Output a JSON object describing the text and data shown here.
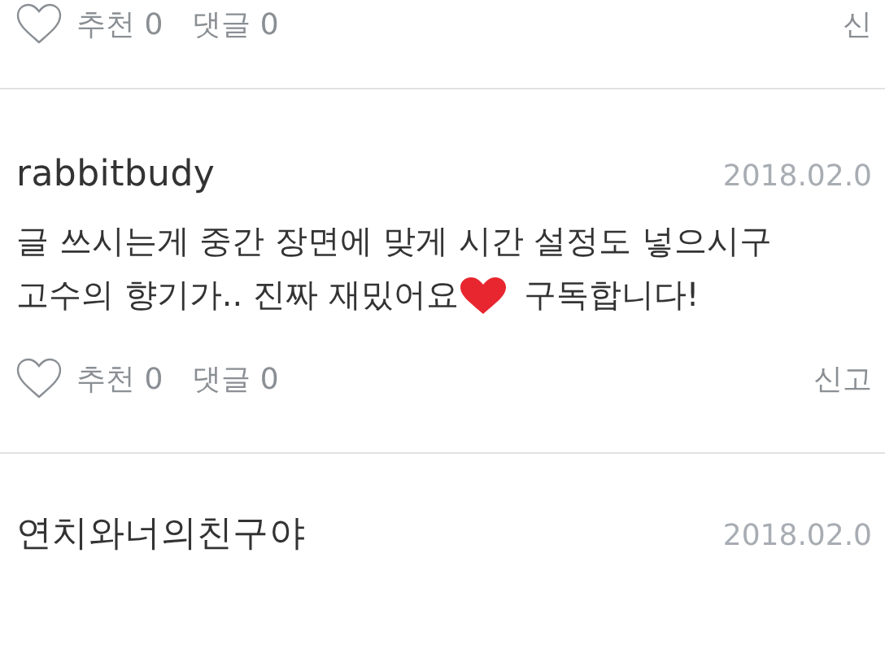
{
  "comments": [
    {
      "actions": {
        "like_label": "추천 0",
        "reply_label": "댓글 0",
        "report_label": "신"
      }
    },
    {
      "author": "rabbitbudy",
      "date": "2018.02.0",
      "body": [
        {
          "kind": "text",
          "text": "글 쓰시는게 중간 장면에 맞게 시간 설정도 넣으시구"
        },
        {
          "kind": "line_with_heart",
          "before": "고수의 향기가.. 진짜 재밌어요",
          "after": "구독합니다!"
        }
      ],
      "actions": {
        "like_label": "추천 0",
        "reply_label": "댓글 0",
        "report_label": "신고"
      }
    },
    {
      "author": "연치와너의친구야",
      "date": "2018.02.0"
    }
  ]
}
